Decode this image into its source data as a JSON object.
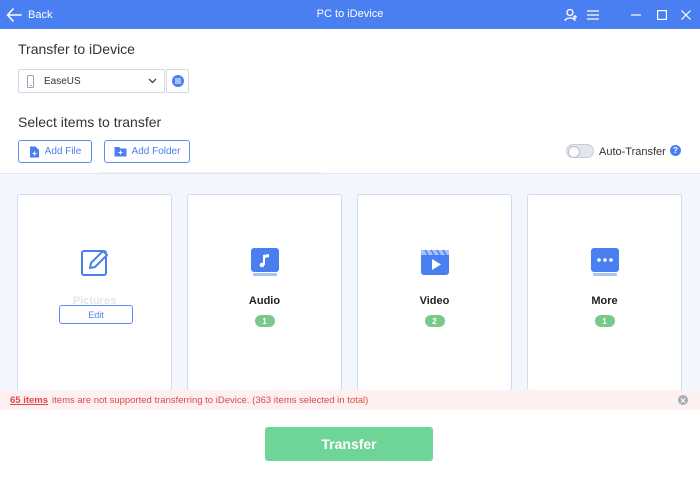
{
  "window": {
    "back_label": "Back",
    "title": "PC to iDevice",
    "title_bar_color": "#4a7ff1",
    "controls": [
      "user-icon",
      "menu-icon",
      "minimize-icon",
      "maximize-icon",
      "close-icon"
    ]
  },
  "transfer_section": {
    "heading": "Transfer to iDevice",
    "device_name": "EaseUS"
  },
  "select_section": {
    "heading": "Select items to transfer",
    "add_file_label": "Add File",
    "add_folder_label": "Add Folder",
    "auto_transfer_label": "Auto-Transfer",
    "auto_transfer_on": false,
    "help_label": "?"
  },
  "categories": [
    {
      "name": "Pictures",
      "icon": "pencil-edit-icon",
      "action_label": "Edit",
      "state": "disabled"
    },
    {
      "name": "Audio",
      "icon": "music-icon",
      "count": "1"
    },
    {
      "name": "Video",
      "icon": "video-play-icon",
      "count": "2"
    },
    {
      "name": "More",
      "icon": "more-dots-icon",
      "count": "1"
    }
  ],
  "error_bar": {
    "count_link": "65 items",
    "message": "items are not supported transferring to iDevice. (363 items selected in total)",
    "text_color": "#e04848"
  },
  "transfer_button": {
    "label": "Transfer",
    "color": "#6fd497"
  }
}
